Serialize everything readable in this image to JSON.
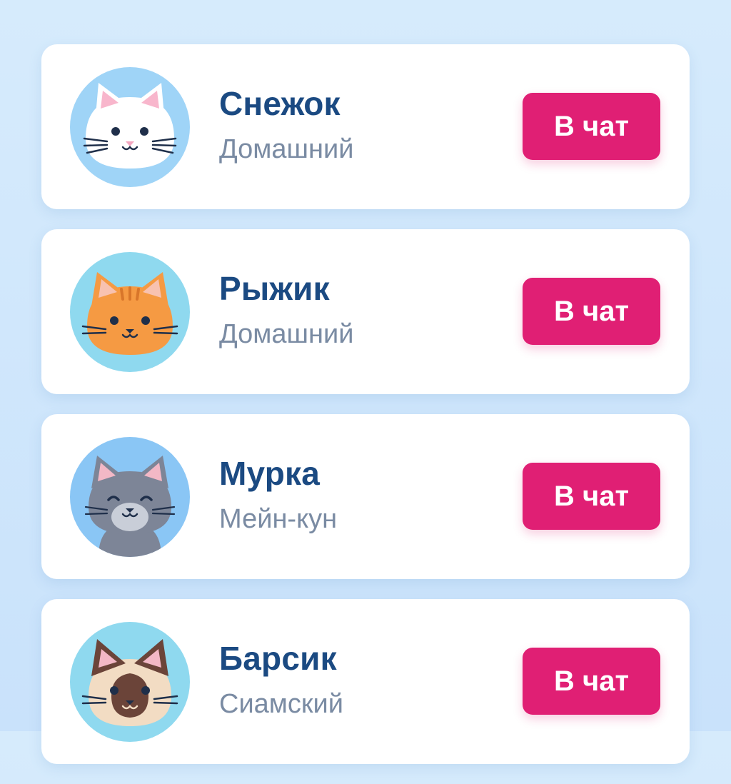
{
  "contacts": [
    {
      "name": "Снежок",
      "breed": "Домашний",
      "button_label": "В чат",
      "avatar_icon": "white-cat-icon",
      "avatar_bg": "#9fd4f7",
      "fur_color": "#ffffff",
      "nose_color": "#f4a6c0"
    },
    {
      "name": "Рыжик",
      "breed": "Домашний",
      "button_label": "В чат",
      "avatar_icon": "orange-cat-icon",
      "avatar_bg": "#8fd9ef",
      "fur_color": "#f59a43",
      "nose_color": "#1f2f4a"
    },
    {
      "name": "Мурка",
      "breed": "Мейн-кун",
      "button_label": "В чат",
      "avatar_icon": "gray-cat-icon",
      "avatar_bg": "#8ac6f5",
      "fur_color": "#7d8597",
      "nose_color": "#1f2f4a"
    },
    {
      "name": "Барсик",
      "breed": "Сиамский",
      "button_label": "В чат",
      "avatar_icon": "siamese-cat-icon",
      "avatar_bg": "#8fd9ef",
      "fur_color": "#f2dcc3",
      "nose_color": "#1f2f4a"
    }
  ],
  "colors": {
    "background": "#d2e9fc",
    "card": "#ffffff",
    "name_text": "#1b4a82",
    "breed_text": "#7a8ba3",
    "button_bg": "#e01f74",
    "button_text": "#ffffff"
  }
}
